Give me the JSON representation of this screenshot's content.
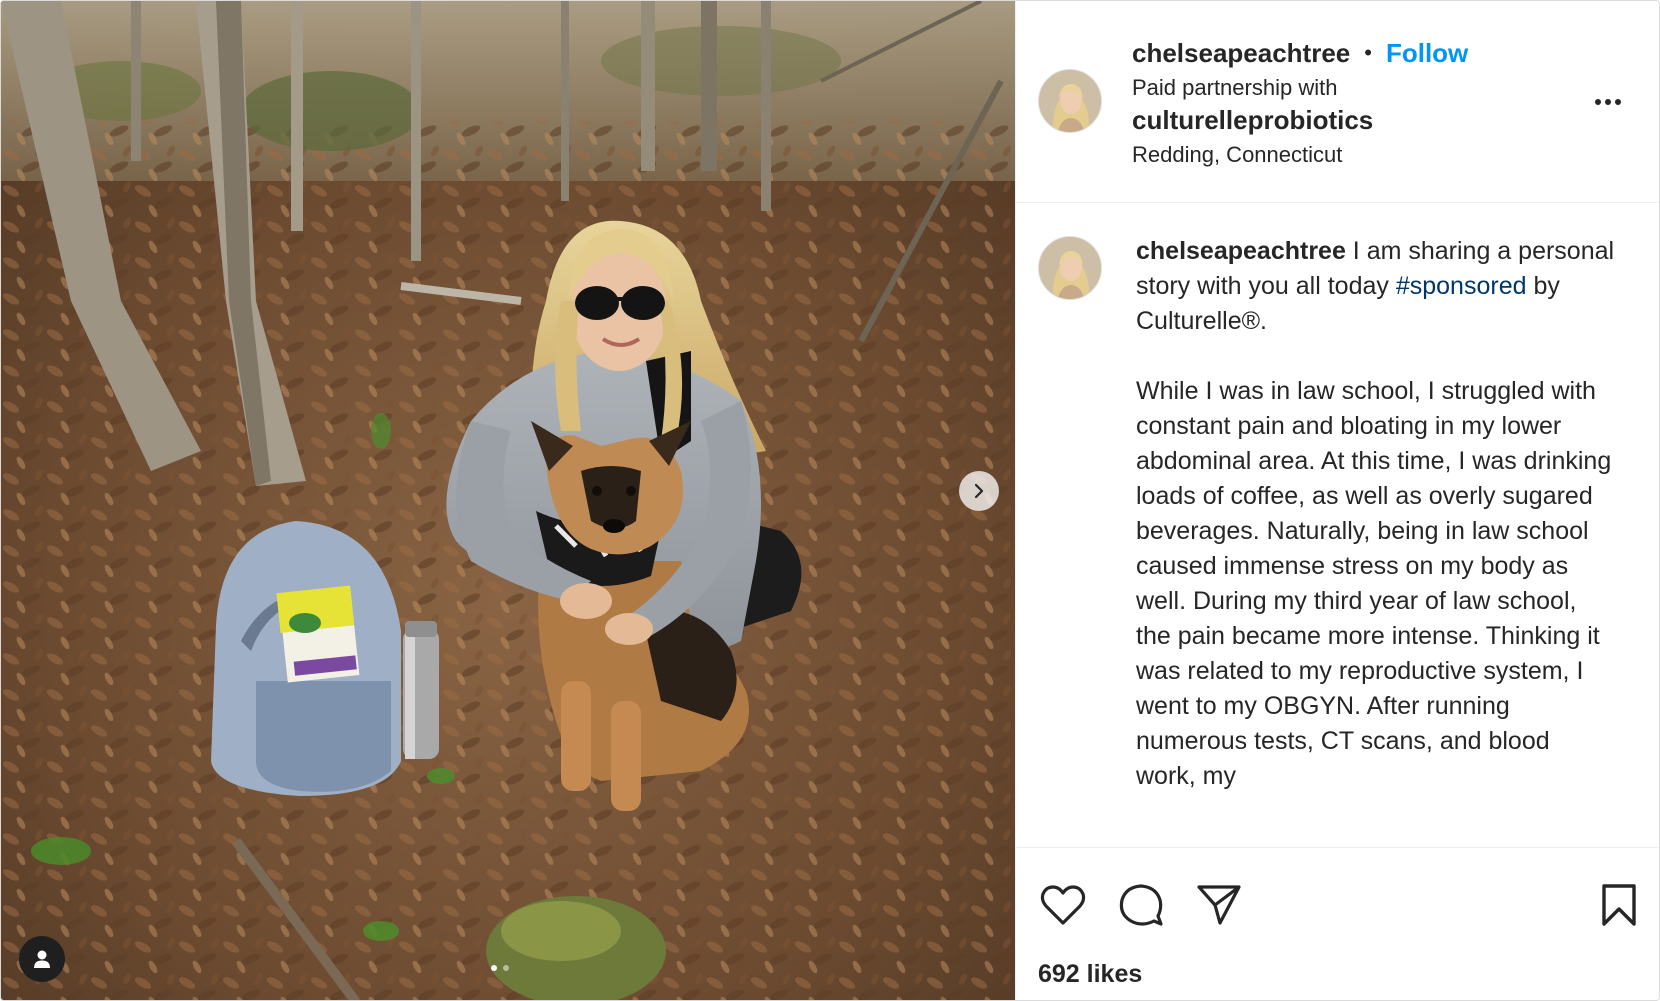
{
  "post": {
    "author": "chelseapeachtree",
    "follow_label": "Follow",
    "separator": "•",
    "paid_partnership_label": "Paid partnership with",
    "partner": "culturelleprobiotics",
    "location": "Redding, Connecticut"
  },
  "caption": {
    "username": "chelseapeachtree",
    "line1": " I am sharing a personal story with you all today ",
    "hashtag": "#sponsored",
    "line1_end": " by Culturelle®.",
    "paragraph": "While I was in law school, I struggled with constant pain and bloating in my lower abdominal area. At this time, I was drinking loads of coffee, as well as overly sugared beverages. Naturally, being in law school caused immense stress on my body as well. During my third year of law school, the pain became more intense. Thinking it was related to my reproductive system, I went to my OBGYN. After running numerous tests, CT scans, and blood work, my"
  },
  "engagement": {
    "likes_label": "692 likes"
  },
  "media": {
    "alt": "Woman with sunglasses hugging a German Shepherd in a forest beside a backpack and water bottle",
    "carousel_index": 1,
    "carousel_total": 2
  },
  "icons": {
    "like": "heart-icon",
    "comment": "comment-icon",
    "share": "paper-plane-icon",
    "save": "bookmark-icon",
    "more": "more-options-icon",
    "next": "chevron-right-icon",
    "tags": "user-tag-icon"
  },
  "colors": {
    "accent": "#0095f6",
    "hashtag": "#00376b",
    "text": "#262626"
  }
}
